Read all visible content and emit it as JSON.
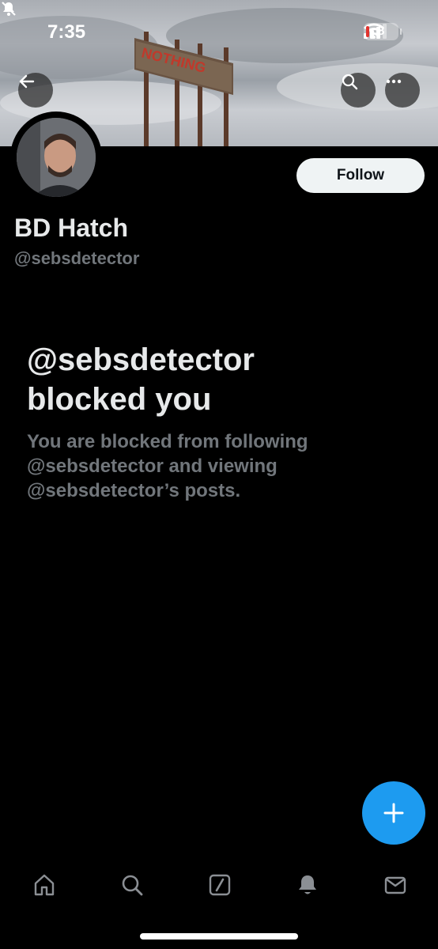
{
  "status_bar": {
    "time": "7:35",
    "battery_level": "8",
    "icons": [
      "bell-slash-icon",
      "signal-icon",
      "wifi-icon",
      "battery-icon"
    ]
  },
  "header": {
    "banner_sign_text": "NOTHING",
    "buttons": [
      "back-arrow-icon",
      "search-icon",
      "more-icon"
    ]
  },
  "profile": {
    "display_name": "BD Hatch",
    "handle": "@sebsdetector",
    "follow_label": "Follow"
  },
  "blocked": {
    "title": "@sebsdetector blocked you",
    "description": "You are blocked from following @sebsdetector and viewing @sebsdetector’s posts."
  },
  "fab": {
    "icon": "plus-icon"
  },
  "tabbar": {
    "items": [
      "home-icon",
      "search-icon",
      "grok-icon",
      "notifications-icon",
      "messages-icon"
    ]
  },
  "colors": {
    "background": "#000000",
    "accent": "#1d9bf0",
    "primary_text": "#e7e9ea",
    "secondary_text": "#71767b",
    "follow_button_bg": "#eff3f4"
  }
}
